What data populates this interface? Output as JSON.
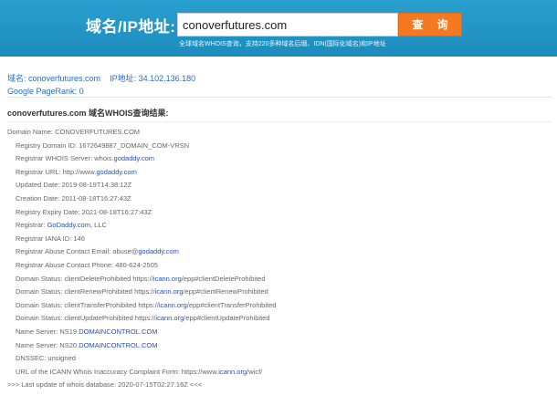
{
  "header": {
    "label": "域名/IP地址:",
    "search_value": "conoverfutures.com",
    "search_button": "查 询",
    "tip": "全球域名WHOIS查询，支持220多种域名后缀、IDN(国际化域名)和IP地址"
  },
  "summary": {
    "domain_prefix": "域名: ",
    "domain": "conoverfutures.com",
    "ip_prefix": "IP地址: ",
    "ip": "34.102.136.180",
    "pagerank_prefix": "Google PageRank: ",
    "pagerank": "0"
  },
  "result_title": "conoverfutures.com 域名WHOIS查询结果:",
  "whois": [
    {
      "indent": false,
      "parts": [
        {
          "t": "Domain Name: CONOVERFUTURES.COM"
        }
      ]
    },
    {
      "indent": true,
      "parts": [
        {
          "t": "Registry Domain ID: 1672649887_DOMAIN_COM-VRSN"
        }
      ]
    },
    {
      "indent": true,
      "parts": [
        {
          "t": "Registrar WHOIS Server: whois."
        },
        {
          "t": "godaddy.com",
          "link": true
        }
      ]
    },
    {
      "indent": true,
      "parts": [
        {
          "t": "Registrar URL: http://www."
        },
        {
          "t": "godaddy.com",
          "link": true
        }
      ]
    },
    {
      "indent": true,
      "parts": [
        {
          "t": "Updated Date: 2019-08-19T14:38:12Z"
        }
      ]
    },
    {
      "indent": true,
      "parts": [
        {
          "t": "Creation Date: 2011-08-18T16:27:43Z"
        }
      ]
    },
    {
      "indent": true,
      "parts": [
        {
          "t": "Registry Expiry Date: 2021-08-18T16:27:43Z"
        }
      ]
    },
    {
      "indent": true,
      "parts": [
        {
          "t": "Registrar: "
        },
        {
          "t": "GoDaddy.com",
          "link": true
        },
        {
          "t": ", LLC"
        }
      ]
    },
    {
      "indent": true,
      "parts": [
        {
          "t": "Registrar IANA ID: 146"
        }
      ]
    },
    {
      "indent": true,
      "parts": [
        {
          "t": "Registrar Abuse Contact Email: abuse@"
        },
        {
          "t": "godaddy.com",
          "link": true
        }
      ]
    },
    {
      "indent": true,
      "parts": [
        {
          "t": "Registrar Abuse Contact Phone: 480-624-2505"
        }
      ]
    },
    {
      "indent": true,
      "parts": [
        {
          "t": "Domain Status: clientDeleteProhibited https://"
        },
        {
          "t": "icann.org",
          "link": true
        },
        {
          "t": "/epp#clientDeleteProhibited"
        }
      ]
    },
    {
      "indent": true,
      "parts": [
        {
          "t": "Domain Status: clientRenewProhibited https://"
        },
        {
          "t": "icann.org",
          "link": true
        },
        {
          "t": "/epp#clientRenewProhibited"
        }
      ]
    },
    {
      "indent": true,
      "parts": [
        {
          "t": "Domain Status: clientTransferProhibited https://"
        },
        {
          "t": "icann.org",
          "link": true
        },
        {
          "t": "/epp#clientTransferProhibited"
        }
      ]
    },
    {
      "indent": true,
      "parts": [
        {
          "t": "Domain Status: clientUpdateProhibited https://"
        },
        {
          "t": "icann.org",
          "link": true
        },
        {
          "t": "/epp#clientUpdateProhibited"
        }
      ]
    },
    {
      "indent": true,
      "parts": [
        {
          "t": "Name Server: NS19."
        },
        {
          "t": "DOMAINCONTROL.COM",
          "link": true
        }
      ]
    },
    {
      "indent": true,
      "parts": [
        {
          "t": "Name Server: NS20."
        },
        {
          "t": "DOMAINCONTROL.COM",
          "link": true
        }
      ]
    },
    {
      "indent": true,
      "parts": [
        {
          "t": "DNSSEC: unsigned"
        }
      ]
    },
    {
      "indent": true,
      "parts": [
        {
          "t": "URL of the ICANN Whois Inaccuracy Complaint Form: https://www."
        },
        {
          "t": "icann.org",
          "link": true
        },
        {
          "t": "/wicf/"
        }
      ]
    },
    {
      "indent": false,
      "parts": [
        {
          "t": ">>> Last update of whois database: 2020-07-15T02:27:16Z <<<"
        }
      ]
    }
  ]
}
